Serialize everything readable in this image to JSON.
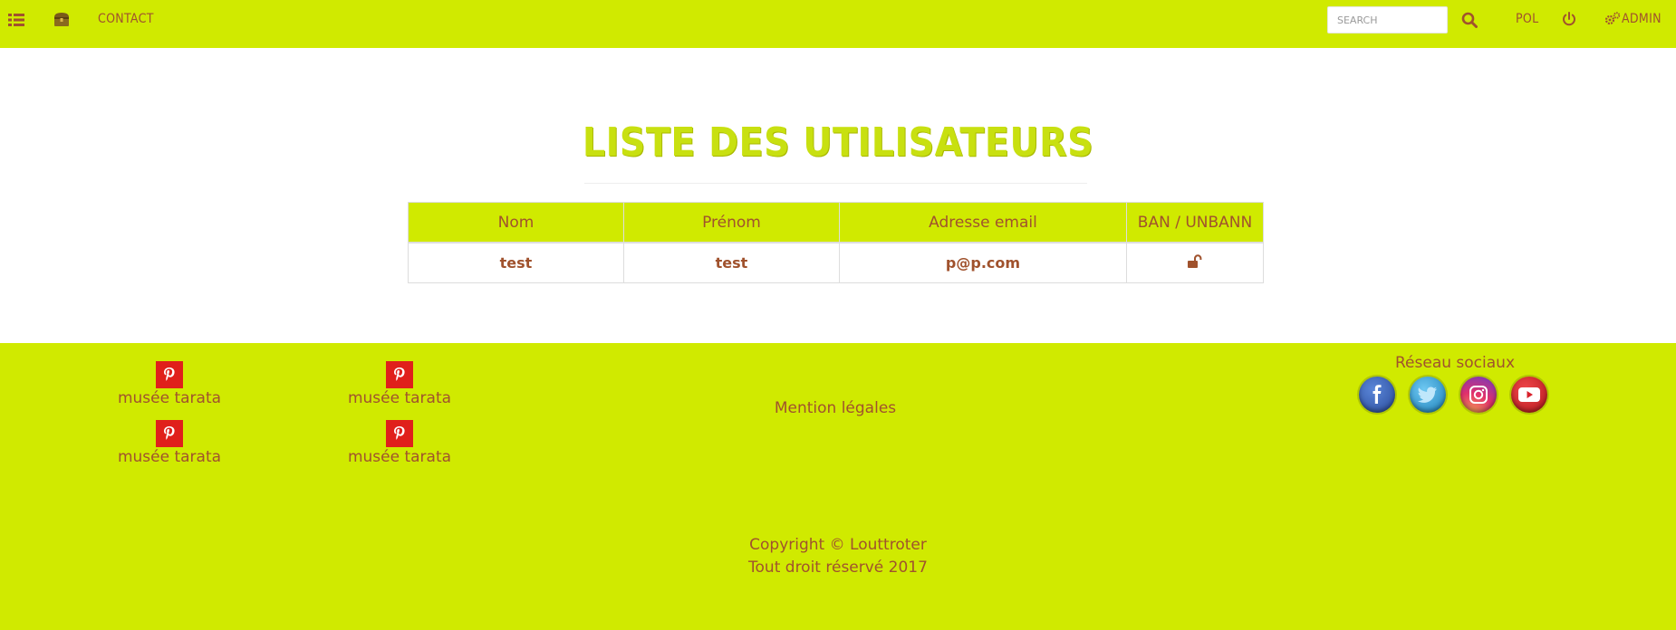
{
  "navbar": {
    "menu_icon": "list-icon",
    "home_icon": "treasure-chest-icon",
    "contact_label": "Contact",
    "search": {
      "placeholder": "Search"
    },
    "search_icon": "search-icon",
    "user_label": "pol",
    "power_icon": "power-icon",
    "admin_icon": "gears-icon",
    "admin_label": "Admin"
  },
  "main": {
    "title": "Liste des utilisateurs",
    "table": {
      "headers": [
        "Nom",
        "Prénom",
        "Adresse email",
        "BAN / UNBANN"
      ],
      "rows": [
        {
          "nom": "test",
          "prenom": "test",
          "email": "p@p.com",
          "action_icon": "unlock-icon"
        }
      ]
    }
  },
  "footer": {
    "pinterest_items": [
      {
        "label": "musée tarata",
        "icon": "pinterest-icon"
      },
      {
        "label": "musée tarata",
        "icon": "pinterest-icon"
      },
      {
        "label": "musée tarata",
        "icon": "pinterest-icon"
      },
      {
        "label": "musée tarata",
        "icon": "pinterest-icon"
      }
    ],
    "legal_link": "Mention légales",
    "social_title": "Réseau sociaux",
    "social_icons": [
      "facebook-icon",
      "twitter-icon",
      "instagram-icon",
      "youtube-icon"
    ],
    "copyright_line1": "Copyright © Louttroter",
    "copyright_line2": "Tout droit réservé 2017"
  },
  "colors": {
    "accent": "#d0ea00",
    "text": "#a0522d",
    "title": "#c8e010",
    "pinterest": "#e0201b"
  }
}
